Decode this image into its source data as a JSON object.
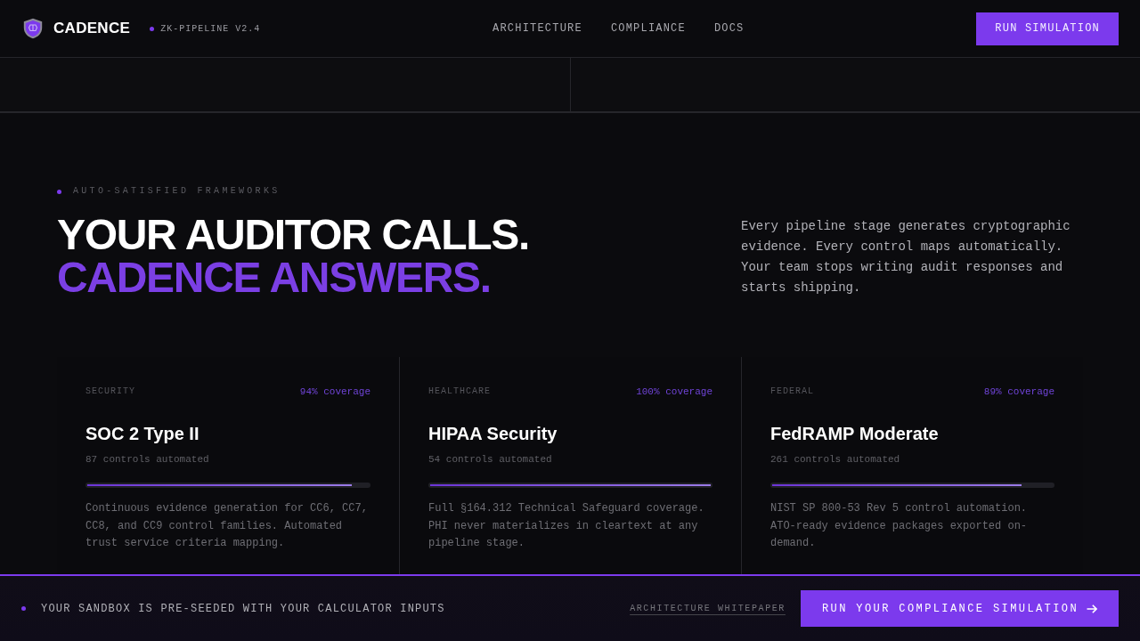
{
  "header": {
    "brand": "CADENCE",
    "version_badge": "ZK-PIPELINE V2.4",
    "nav": [
      "ARCHITECTURE",
      "COMPLIANCE",
      "DOCS"
    ],
    "cta": "RUN SIMULATION"
  },
  "frameworks_section": {
    "eyebrow": "AUTO-SATISFIED FRAMEWORKS",
    "headline": "YOUR AUDITOR CALLS.",
    "headline_accent": "CADENCE ANSWERS.",
    "intro": "Every pipeline stage generates cryptographic evidence. Every control maps automatically. Your team stops writing audit responses and starts shipping.",
    "cards": [
      {
        "category": "SECURITY",
        "coverage": "94% coverage",
        "title": "SOC 2 Type II",
        "controls": "87 controls automated",
        "level": 0.94,
        "description": "Continuous evidence generation for CC6, CC7, CC8, and CC9 control families. Automated trust service criteria mapping."
      },
      {
        "category": "HEALTHCARE",
        "coverage": "100% coverage",
        "title": "HIPAA Security",
        "controls": "54 controls automated",
        "level": 1,
        "description": "Full §164.312 Technical Safeguard coverage. PHI never materializes in cleartext at any pipeline stage."
      },
      {
        "category": "FEDERAL",
        "coverage": "89% coverage",
        "title": "FedRAMP Moderate",
        "controls": "261 controls automated",
        "level": 0.89,
        "description": "NIST SP 800-53 Rev 5 control automation. ATO-ready evidence packages exported on-demand."
      }
    ]
  },
  "bottom_bar": {
    "message": "YOUR SANDBOX IS PRE-SEEDED WITH YOUR CALCULATOR INPUTS",
    "link": "ARCHITECTURE WHITEPAPER",
    "cta": "RUN YOUR COMPLIANCE SIMULATION"
  }
}
